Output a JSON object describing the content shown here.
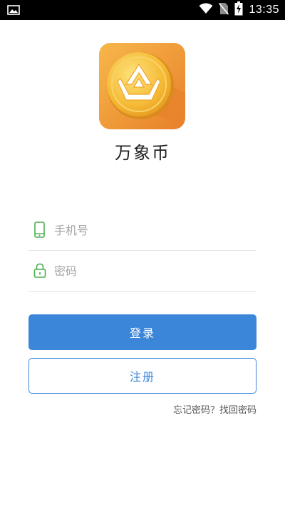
{
  "status_bar": {
    "time": "13:35",
    "icons": [
      "image-icon",
      "wifi-icon",
      "no-sim-icon",
      "battery-charging-icon"
    ]
  },
  "app": {
    "name": "万象币",
    "logo_icon": "coin-crown-logo-icon"
  },
  "form": {
    "phone": {
      "value": "",
      "placeholder": "手机号",
      "icon": "phone-icon"
    },
    "password": {
      "value": "",
      "placeholder": "密码",
      "icon": "lock-icon"
    }
  },
  "buttons": {
    "login_label": "登录",
    "register_label": "注册"
  },
  "forgot_password_label": "忘记密码？找回密码",
  "colors": {
    "primary": "#3b86d8",
    "field_icon": "#4caf50",
    "logo_orange": "#f39a2a",
    "logo_gold": "#f7c843"
  }
}
